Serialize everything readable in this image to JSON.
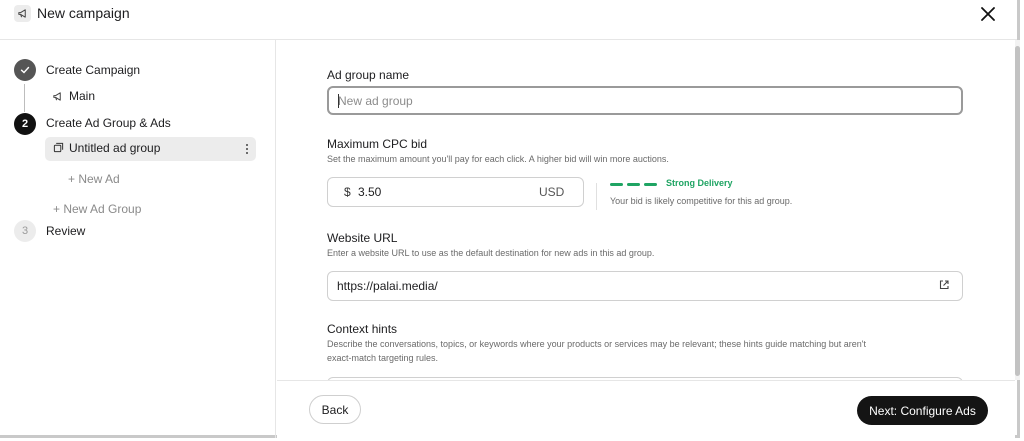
{
  "header": {
    "title": "New campaign",
    "icon": "megaphone-icon"
  },
  "sidebar": {
    "steps": [
      {
        "number": "✓",
        "label": "Create Campaign",
        "state": "done"
      },
      {
        "number": "2",
        "label": "Create Ad Group & Ads",
        "state": "active"
      },
      {
        "number": "3",
        "label": "Review",
        "state": "pending"
      }
    ],
    "campaign_item": "Main",
    "ad_group_item": "Untitled ad group",
    "new_ad": "+ New Ad",
    "new_ad_group": "+ New Ad Group"
  },
  "form": {
    "ad_group_name": {
      "label": "Ad group name",
      "placeholder": "New ad group",
      "value": ""
    },
    "cpc": {
      "label": "Maximum CPC bid",
      "help": "Set the maximum amount you'll pay for each click. A higher bid will win more auctions.",
      "currency_symbol": "$",
      "value": "3.50",
      "currency": "USD",
      "delivery_label": "Strong Delivery",
      "delivery_help": "Your bid is likely competitive for this ad group.",
      "delivery_color": "#1fa463"
    },
    "website": {
      "label": "Website URL",
      "help": "Enter a website URL to use as the default destination for new ads in this ad group.",
      "value": "https://palai.media/"
    },
    "context": {
      "label": "Context hints",
      "help_line1": "Describe the conversations, topics, or keywords where your products or services may be relevant; these hints guide matching but aren't",
      "help_line2": "exact-match targeting rules."
    }
  },
  "footer": {
    "back_label": "Back",
    "next_label": "Next: Configure Ads"
  }
}
